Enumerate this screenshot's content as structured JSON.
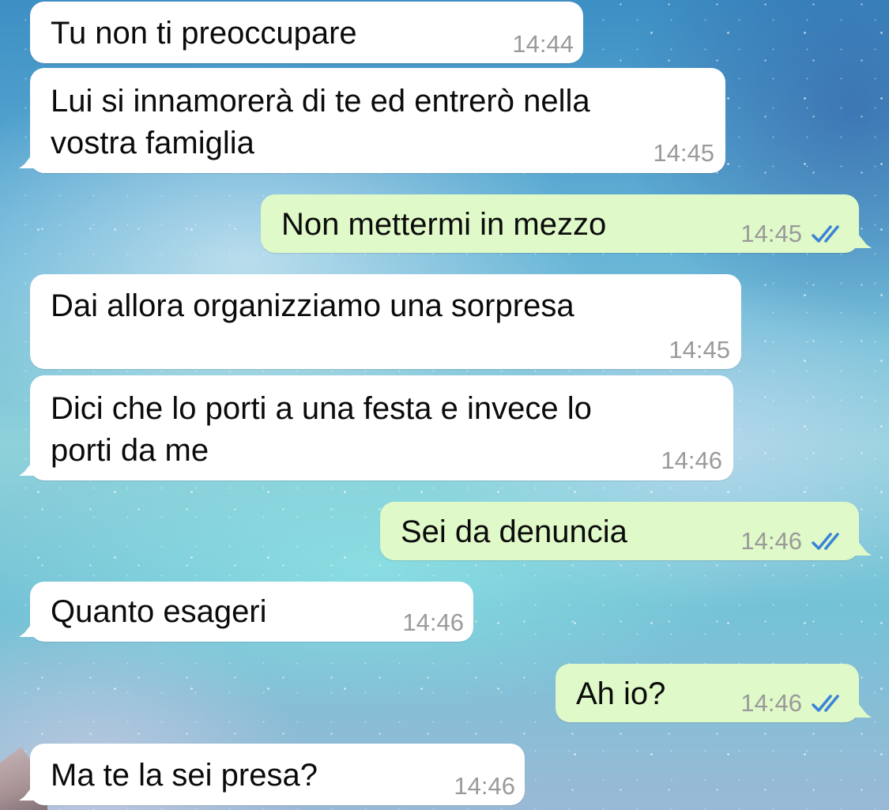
{
  "messages": [
    {
      "direction": "in",
      "text": "Tu non ti preoccupare",
      "time": "14:44"
    },
    {
      "direction": "in",
      "text": "Lui si innamorerà di te ed entrerò nella\nvostra famiglia",
      "time": "14:45"
    },
    {
      "direction": "out",
      "text": "Non mettermi in mezzo",
      "time": "14:45",
      "status": "read"
    },
    {
      "direction": "in",
      "text": "Dai allora organizziamo una sorpresa",
      "time": "14:45"
    },
    {
      "direction": "in",
      "text": "Dici che lo porti a una festa e invece lo\nporti da me",
      "time": "14:46"
    },
    {
      "direction": "out",
      "text": "Sei da denuncia",
      "time": "14:46",
      "status": "read"
    },
    {
      "direction": "in",
      "text": "Quanto esageri",
      "time": "14:46"
    },
    {
      "direction": "out",
      "text": "Ah io?",
      "time": "14:46",
      "status": "read"
    },
    {
      "direction": "in",
      "text": "Ma te la sei presa?",
      "time": "14:46"
    }
  ],
  "colors": {
    "incoming_bubble": "#ffffff",
    "outgoing_bubble": "#e0f9c8",
    "read_ticks": "#3b83d8",
    "timestamp": "#9a9a9a"
  },
  "icons": {
    "read_status": "double-check-icon"
  }
}
